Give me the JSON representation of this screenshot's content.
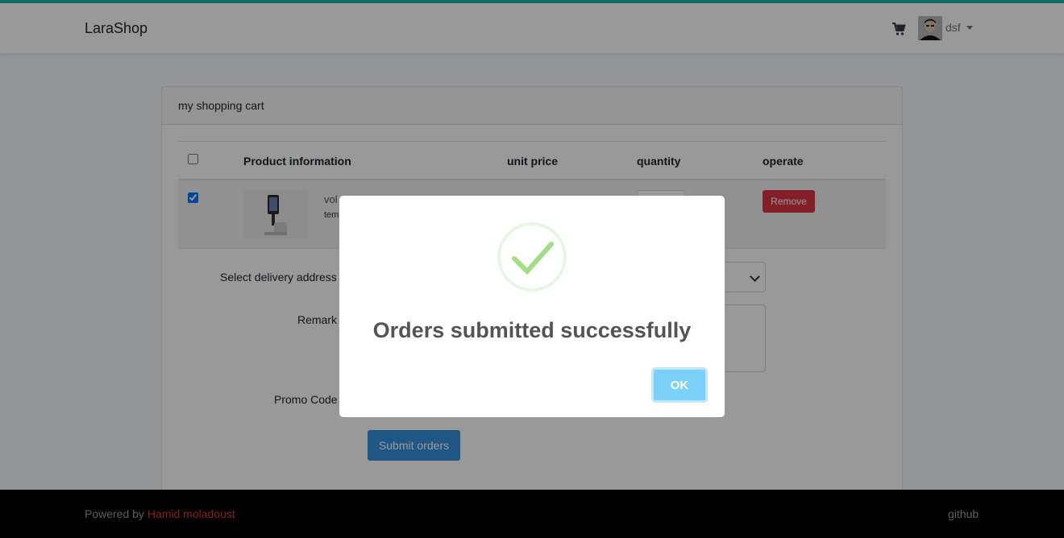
{
  "navbar": {
    "brand": "LaraShop",
    "cart_icon": "shopping-cart-icon",
    "username": "dsf"
  },
  "cart": {
    "header": "my shopping cart",
    "columns": [
      "Product information",
      "unit price",
      "quantity",
      "operate"
    ],
    "items": [
      {
        "name": "vol",
        "subtitle": "tem",
        "checked": true,
        "remove_label": "Remove"
      }
    ]
  },
  "form": {
    "address_label": "Select delivery address",
    "remark_label": "Remark",
    "promo_label": "Promo Code",
    "submit_label": "Submit orders"
  },
  "footer": {
    "powered_by": "Powered by",
    "author": "Hamid moladoust",
    "github": "github"
  },
  "modal": {
    "title": "Orders submitted successfully",
    "ok_label": "OK",
    "icon": "success-check-icon"
  },
  "colors": {
    "accent_topline": "#20b2aa",
    "primary": "#3490dc",
    "danger": "#dc3545",
    "modal_ok": "#7cd1f9",
    "success_check": "#a5dc86"
  }
}
